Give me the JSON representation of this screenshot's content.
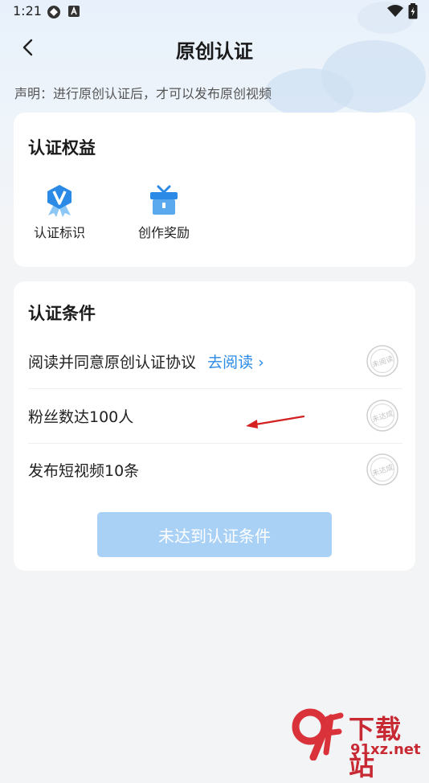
{
  "status_bar": {
    "time": "1:21"
  },
  "nav": {
    "title": "原创认证"
  },
  "notice": "声明：进行原创认证后，才可以发布原创视频",
  "benefits": {
    "title": "认证权益",
    "items": [
      {
        "label": "认证标识",
        "icon": "verified-badge-icon"
      },
      {
        "label": "创作奖励",
        "icon": "gift-box-icon"
      }
    ]
  },
  "conditions": {
    "title": "认证条件",
    "items": [
      {
        "text": "阅读并同意原创认证协议",
        "link": "去阅读 ›",
        "stamp": "未阅读"
      },
      {
        "text": "粉丝数达100人",
        "stamp": "未达成"
      },
      {
        "text": "发布短视频10条",
        "stamp": "未达成"
      }
    ],
    "button": "未达到认证条件"
  },
  "watermark": {
    "brand": "下载站",
    "site": "91xz.net",
    "logo": "9f"
  },
  "colors": {
    "accent": "#2b8ae6",
    "button_disabled": "#a9d1f6",
    "background": "#f3f4f6",
    "arrow": "#d42020"
  }
}
